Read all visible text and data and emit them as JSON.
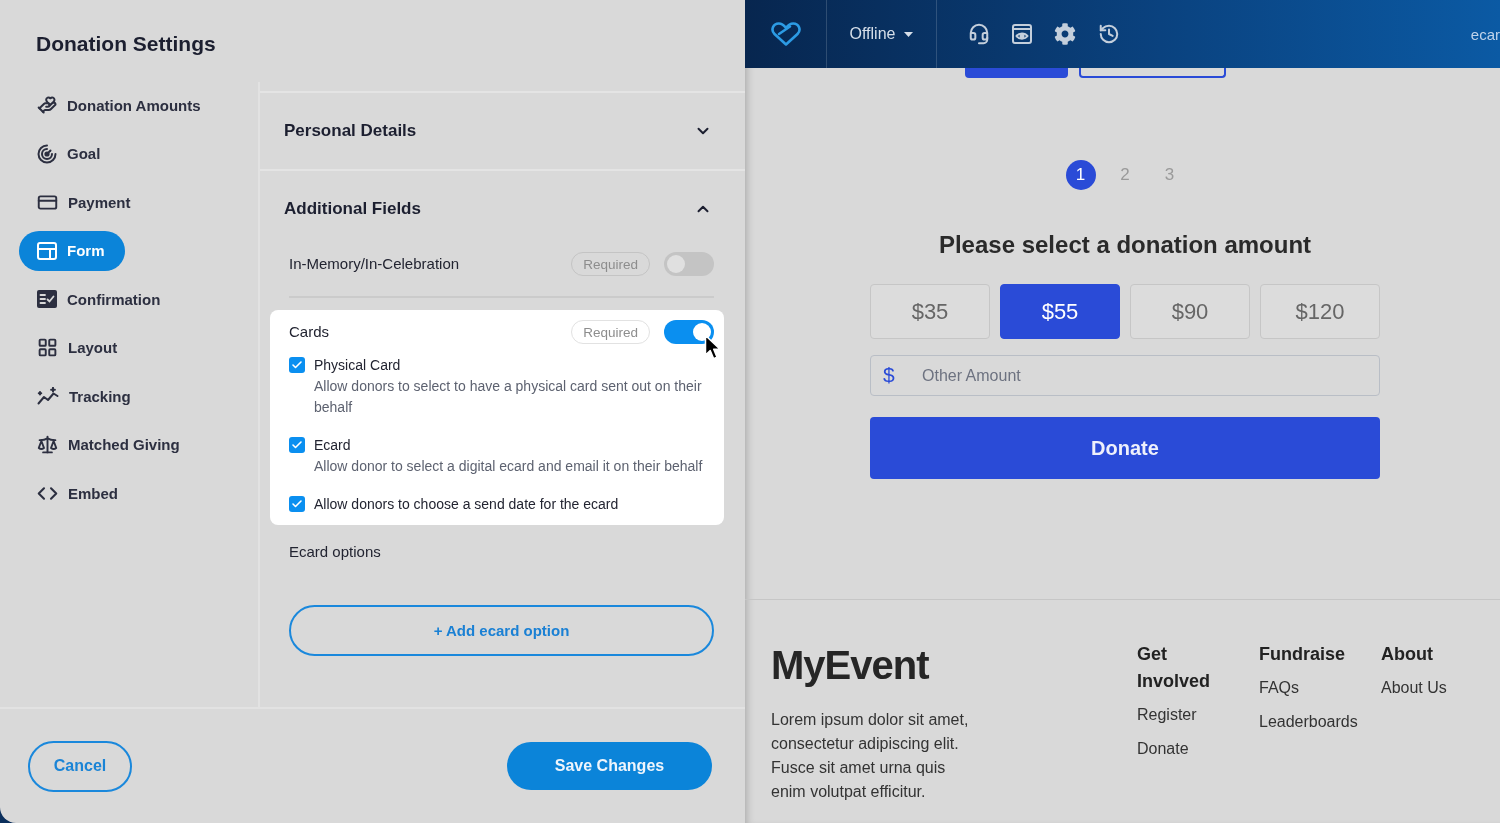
{
  "settings": {
    "title": "Donation Settings",
    "nav_items": [
      {
        "label": "Donation Amounts",
        "selected": false
      },
      {
        "label": "Goal",
        "selected": false
      },
      {
        "label": "Payment",
        "selected": false
      },
      {
        "label": "Form",
        "selected": true
      },
      {
        "label": "Confirmation",
        "selected": false
      },
      {
        "label": "Layout",
        "selected": false
      },
      {
        "label": "Tracking",
        "selected": false
      },
      {
        "label": "Matched Giving",
        "selected": false
      },
      {
        "label": "Embed",
        "selected": false
      }
    ],
    "sections": [
      {
        "title": "Personal Details",
        "expanded": false
      },
      {
        "title": "Additional Fields",
        "expanded": true,
        "fields": [
          {
            "label": "In-Memory/In-Celebration",
            "badge": "Required",
            "on": false
          },
          {
            "label": "Cards",
            "badge": "Required",
            "on": true,
            "options": [
              {
                "label": "Physical Card",
                "description": "Allow donors to select to have a physical card sent out on their behalf",
                "checked": true
              },
              {
                "label": "Ecard",
                "description": "Allow donor to select a digital ecard and email it on their behalf",
                "checked": true
              },
              {
                "label": "Allow donors to choose a send date for the ecard",
                "checked": true
              }
            ]
          }
        ],
        "ecard_options": {
          "label": "Ecard options",
          "add_button": "+ Add ecard option"
        }
      }
    ],
    "footer": {
      "cancel_button": "Cancel",
      "save_button": "Save Changes"
    }
  },
  "preview": {
    "top_bar": {
      "status": "Offline",
      "account": "ecar"
    },
    "steps": [
      {
        "label": "1",
        "selected": true
      },
      {
        "label": "2",
        "selected": false
      },
      {
        "label": "3",
        "selected": false
      }
    ],
    "heading": "Please select a donation amount",
    "amounts": [
      {
        "label": "$35",
        "selected": false
      },
      {
        "label": "$55",
        "selected": true
      },
      {
        "label": "$90",
        "selected": false
      },
      {
        "label": "$120",
        "selected": false
      }
    ],
    "other_amount": {
      "prefix": "$",
      "placeholder": "Other Amount"
    },
    "donate_button": "Donate",
    "footer": {
      "brand": "MyEvent",
      "description": "Lorem ipsum dolor sit amet, consectetur adipiscing elit. Fusce sit amet urna quis enim volutpat efficitur.",
      "columns": [
        {
          "heading": "Get Involved",
          "links": [
            "Register",
            "Donate"
          ]
        },
        {
          "heading": "Fundraise",
          "links": [
            "FAQs",
            "Leaderboards"
          ]
        },
        {
          "heading": "About",
          "links": [
            "About Us"
          ]
        }
      ]
    }
  }
}
